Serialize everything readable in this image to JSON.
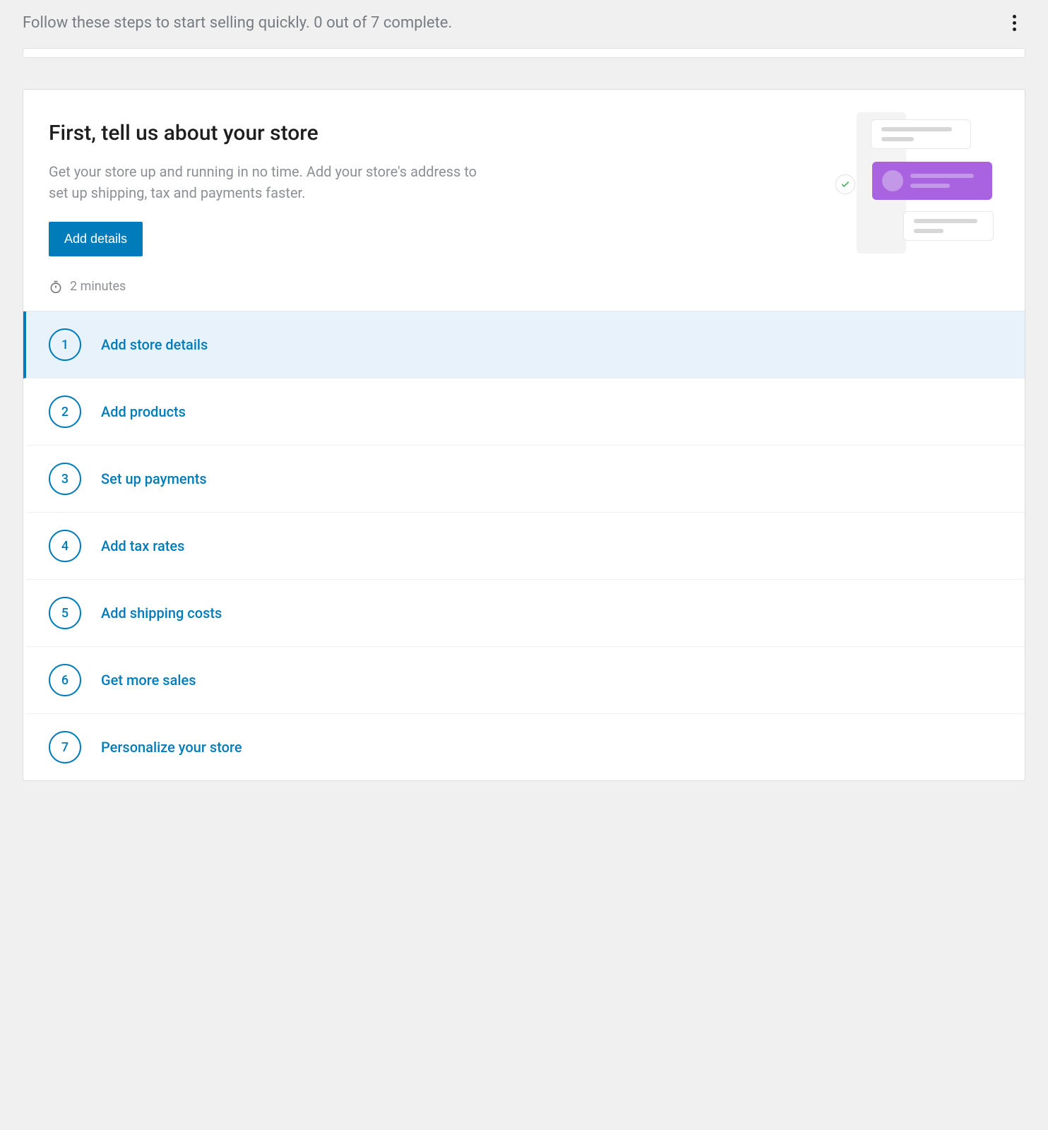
{
  "header": {
    "progress_text": "Follow these steps to start selling quickly. 0 out of 7 complete."
  },
  "hero": {
    "title": "First, tell us about your store",
    "subtitle": "Get your store up and running in no time. Add your store's address to set up shipping, tax and payments faster.",
    "button_label": "Add details",
    "time_estimate": "2 minutes"
  },
  "tasks": [
    {
      "number": "1",
      "label": "Add store details",
      "active": true
    },
    {
      "number": "2",
      "label": "Add products",
      "active": false
    },
    {
      "number": "3",
      "label": "Set up payments",
      "active": false
    },
    {
      "number": "4",
      "label": "Add tax rates",
      "active": false
    },
    {
      "number": "5",
      "label": "Add shipping costs",
      "active": false
    },
    {
      "number": "6",
      "label": "Get more sales",
      "active": false
    },
    {
      "number": "7",
      "label": "Personalize your store",
      "active": false
    }
  ]
}
